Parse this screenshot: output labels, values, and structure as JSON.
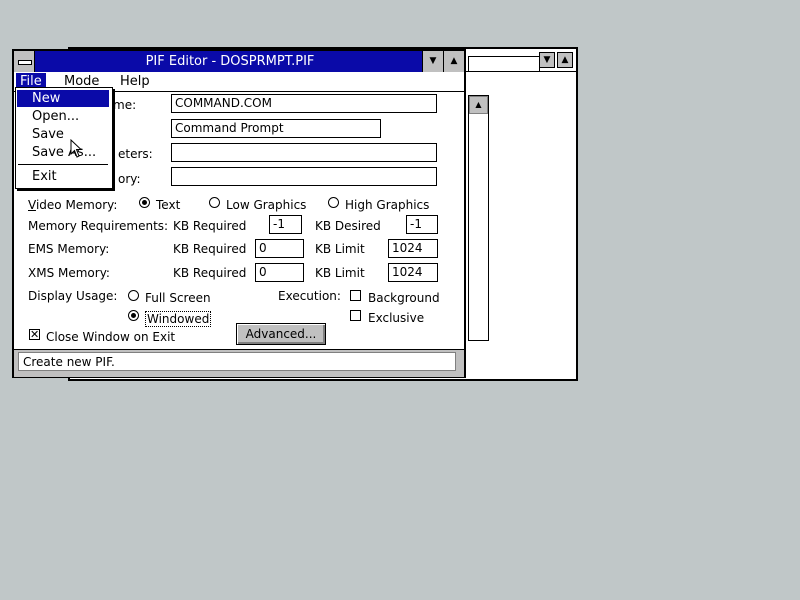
{
  "window": {
    "title": "PIF Editor - DOSPRMPT.PIF",
    "minimize_icon": "down-arrow",
    "maximize_icon": "up-arrow"
  },
  "menu": {
    "file": "File",
    "mode": "Mode",
    "help": "Help"
  },
  "file_menu": {
    "new": "New",
    "open": "Open...",
    "save": "Save",
    "save_as": "Save As...",
    "exit": "Exit"
  },
  "form": {
    "program_filename_label": "me:",
    "program_filename": "COMMAND.COM",
    "window_title": "Command Prompt",
    "parameters_label": "eters:",
    "parameters": "",
    "startup_dir_label": "ory:",
    "startup_dir": "",
    "video_memory_label": "Video Memory:",
    "video_options": [
      "Text",
      "Low Graphics",
      "High Graphics"
    ],
    "video_selected": "Text",
    "memory_req_label": "Memory Requirements:",
    "kb_required_label": "KB Required",
    "kb_desired_label": "KB Desired",
    "mem_required": "-1",
    "mem_desired": "-1",
    "ems_label": "EMS Memory:",
    "kb_limit_label": "KB Limit",
    "ems_required": "0",
    "ems_limit": "1024",
    "xms_label": "XMS Memory:",
    "xms_required": "0",
    "xms_limit": "1024",
    "display_usage_label": "Display Usage:",
    "full_screen": "Full Screen",
    "windowed": "Windowed",
    "display_selected": "Windowed",
    "execution_label": "Execution:",
    "background": "Background",
    "exclusive": "Exclusive",
    "background_checked": false,
    "exclusive_checked": false,
    "close_on_exit": "Close Window on Exit",
    "close_on_exit_checked": true,
    "advanced_button": "Advanced..."
  },
  "status": {
    "text": "Create new PIF."
  }
}
